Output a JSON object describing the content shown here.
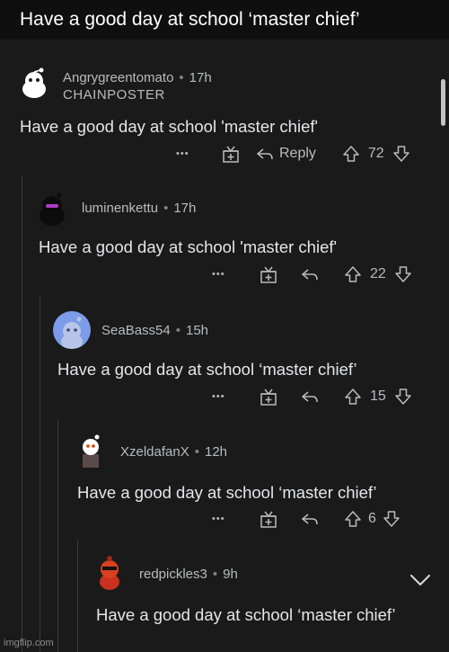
{
  "caption": "Have a good day at school ‘master chief’",
  "comments": [
    {
      "author": "Angrygreentomato",
      "time": "17h",
      "flair": "CHAINPOSTER",
      "text": "Have a good day at school 'master chief'",
      "more": "•••",
      "reply": "Reply",
      "votes": "72"
    },
    {
      "author": "luminenkettu",
      "time": "17h",
      "text": "Have a good day at school 'master chief'",
      "more": "•••",
      "votes": "22"
    },
    {
      "author": "SeaBass54",
      "time": "15h",
      "text": "Have a good day at school ‘master chief’",
      "more": "•••",
      "votes": "15"
    },
    {
      "author": "XzeldafanX",
      "time": "12h",
      "text": "Have a good day at school ‘master chief’",
      "more": "•••",
      "votes": "6"
    },
    {
      "author": "redpickles3",
      "time": "9h",
      "text": "Have a good day at school ‘master chief’"
    }
  ],
  "separator": "•",
  "watermark": "imgflip.com",
  "colors": {
    "background": "#1a1a1b",
    "text": "#d7dadc",
    "muted": "#818384"
  }
}
